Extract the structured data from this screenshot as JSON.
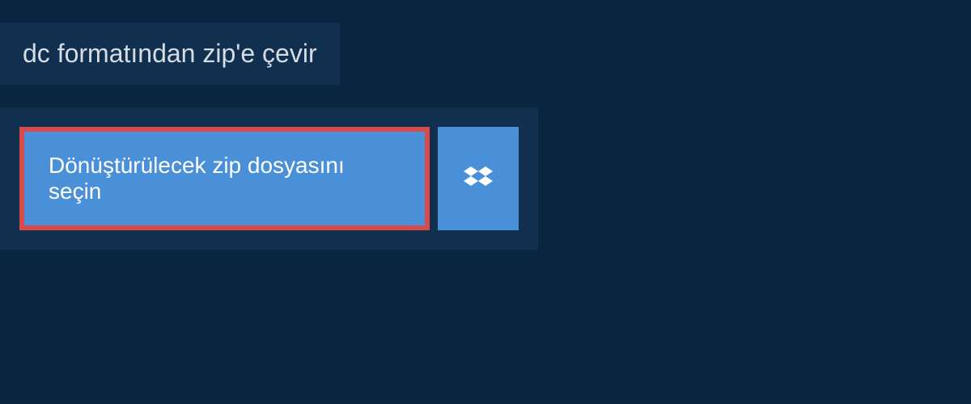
{
  "header": {
    "title": "dc formatından zip'e çevir"
  },
  "upload": {
    "select_file_label": "Dönüştürülecek zip dosyasını seçin"
  },
  "colors": {
    "background": "#0a2540",
    "panel": "#11304f",
    "button": "#4a90d9",
    "highlight_border": "#d94a4a",
    "text_light": "#d5dce3",
    "text_white": "#ffffff"
  }
}
